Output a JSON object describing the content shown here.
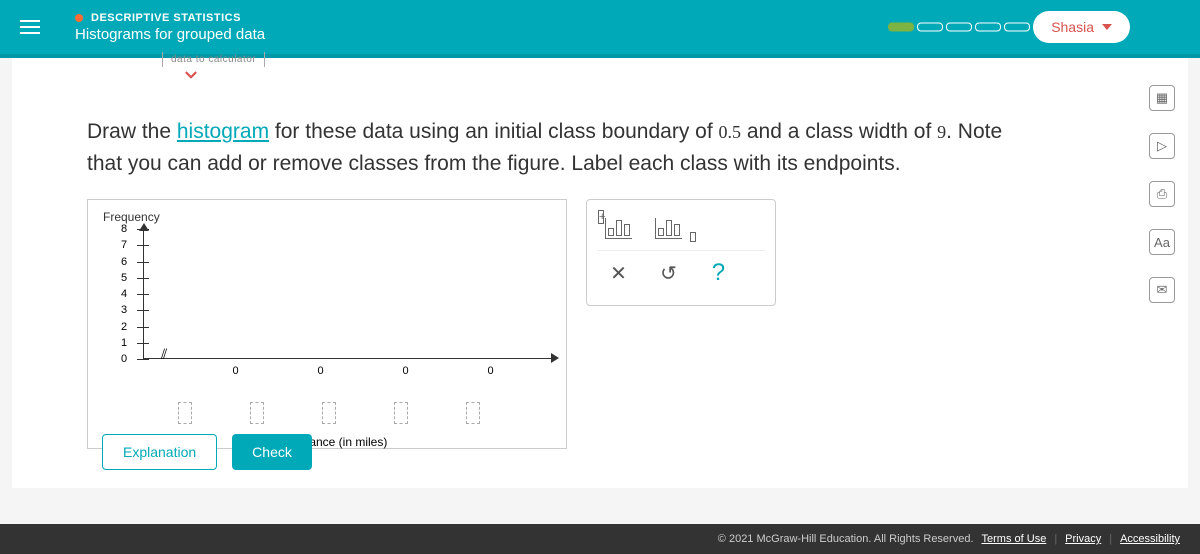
{
  "header": {
    "category": "DESCRIPTIVE STATISTICS",
    "subtitle": "Histograms for grouped data",
    "user": "Shasia",
    "progress_segments": 5,
    "progress_filled": 1
  },
  "calc_tab": "data to calculator",
  "instruction": {
    "pre": "Draw the ",
    "link": "histogram",
    "mid1": " for these data using an initial class boundary of ",
    "num1": "0.5",
    "mid2": " and a class width of ",
    "num2": "9",
    "mid3": ". Note that you can add or remove classes from the figure. Label each class with its endpoints."
  },
  "chart_data": {
    "type": "bar",
    "ylabel": "Frequency",
    "xlabel": "Distance (in miles)",
    "y_ticks": [
      0,
      1,
      2,
      3,
      4,
      5,
      6,
      7,
      8
    ],
    "bars": [
      {
        "value": 0
      },
      {
        "value": 0
      },
      {
        "value": 0
      },
      {
        "value": 0
      }
    ],
    "x_inputs": 5
  },
  "tools": {
    "close": "✕",
    "undo": "↺",
    "help": "?"
  },
  "buttons": {
    "explanation": "Explanation",
    "check": "Check"
  },
  "side_tool_labels": {
    "calculator": "▦",
    "play": "▷",
    "book": "⎙",
    "aa": "Aa",
    "mail": "✉"
  },
  "footer": {
    "copyright": "© 2021 McGraw-Hill Education. All Rights Reserved.",
    "terms": "Terms of Use",
    "privacy": "Privacy",
    "accessibility": "Accessibility"
  }
}
